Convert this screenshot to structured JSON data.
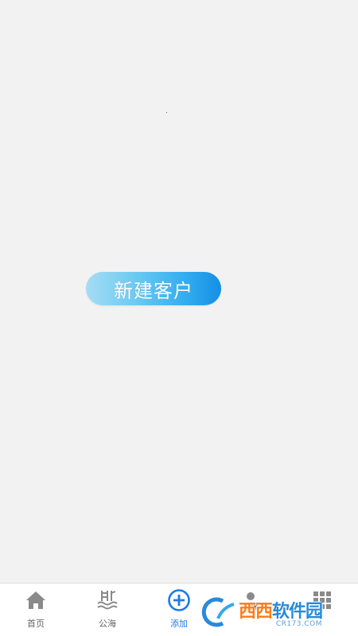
{
  "main": {
    "new_customer_label": "新建客户"
  },
  "tabbar": {
    "items": [
      {
        "label": "首页",
        "icon": "home-icon"
      },
      {
        "label": "公海",
        "icon": "sea-icon"
      },
      {
        "label": "添加",
        "icon": "add-circle-icon",
        "active": true
      },
      {
        "label": "",
        "icon": "person-icon"
      },
      {
        "label": "",
        "icon": "grid-icon"
      }
    ],
    "active_color": "#1f7ae8",
    "inactive_color": "#666666"
  },
  "watermark": {
    "brand": "西西软件园",
    "brand_part1": "西西",
    "brand_part2": "软件园",
    "url": "CR173.COM"
  }
}
